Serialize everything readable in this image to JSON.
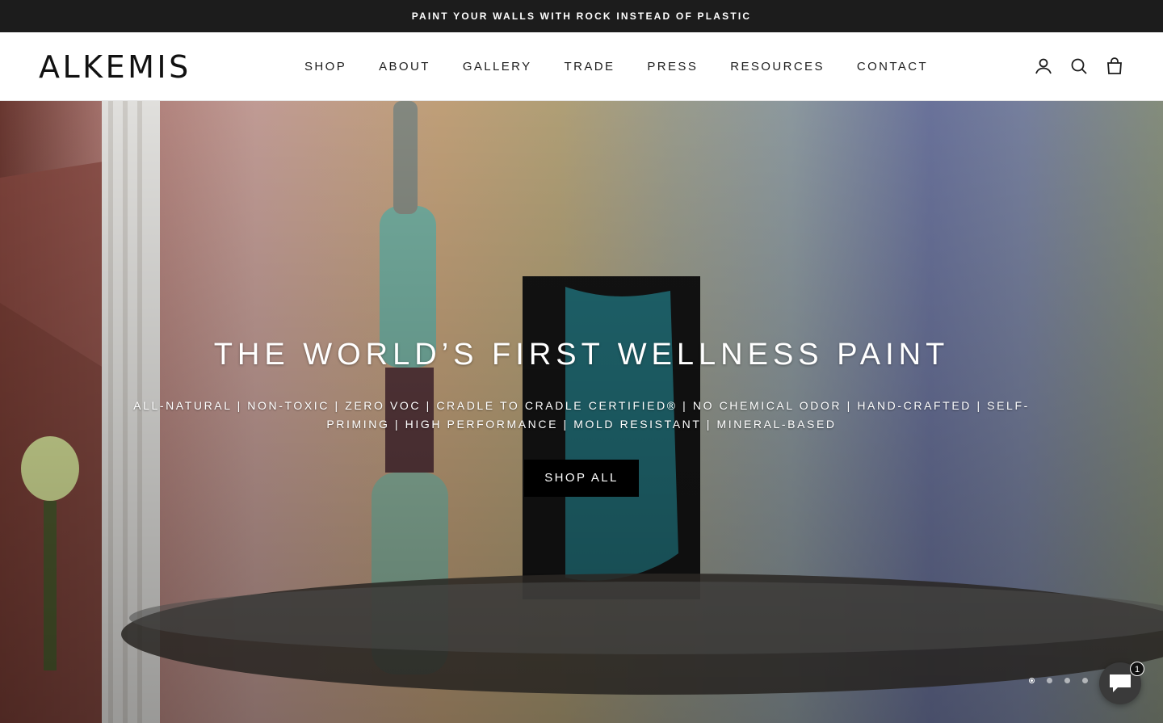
{
  "announcement": {
    "text": "PAINT YOUR WALLS WITH ROCK INSTEAD OF PLASTIC"
  },
  "header": {
    "logo": "ALKEMIS",
    "nav": [
      "SHOP",
      "ABOUT",
      "GALLERY",
      "TRADE",
      "PRESS",
      "RESOURCES",
      "CONTACT"
    ],
    "icons": [
      "account-icon",
      "search-icon",
      "cart-icon"
    ]
  },
  "hero": {
    "title": "THE WORLD’S FIRST WELLNESS PAINT",
    "subtitle": "ALL-NATURAL | NON-TOXIC | ZERO VOC | CRADLE TO CRADLE CERTIFIED® | NO CHEMICAL ODOR | HAND-CRAFTED | SELF-PRIMING | HIGH PERFORMANCE | MOLD RESISTANT | MINERAL-BASED",
    "button_label": "SHOP ALL",
    "slides": {
      "count": 4,
      "active": 1
    }
  },
  "chat": {
    "badge_count": "1"
  },
  "colors": {
    "announcement_bg": "#1c1c1c",
    "button_bg": "#000000",
    "text": "#1c1c1c"
  }
}
